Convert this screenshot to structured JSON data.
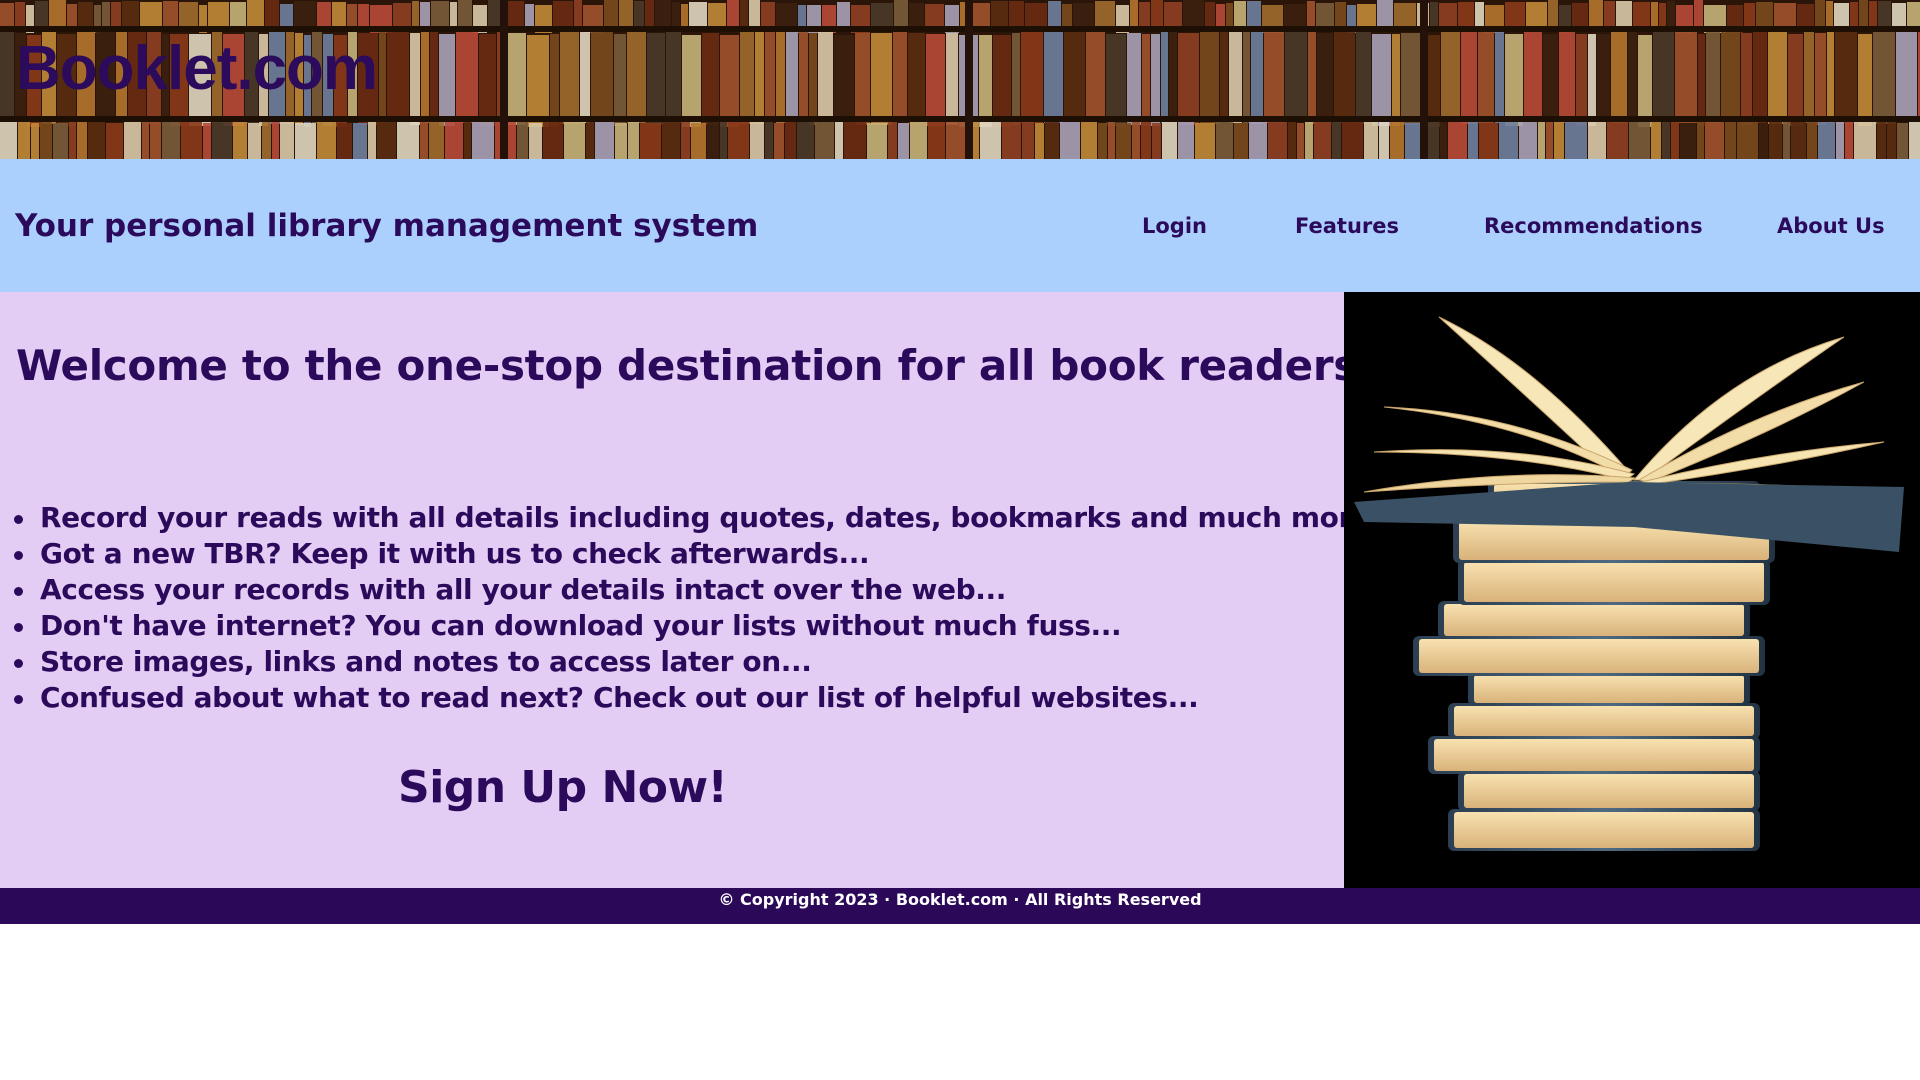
{
  "header": {
    "brand": "Booklet.com"
  },
  "nav": {
    "tagline": "Your personal library management system",
    "links": [
      {
        "label": "Login"
      },
      {
        "label": "Features"
      },
      {
        "label": "Recommendations"
      },
      {
        "label": "About Us"
      }
    ]
  },
  "main": {
    "welcome": "Welcome to the one-stop destination for all book readers!",
    "features": [
      "Record your reads with all details including quotes, dates, bookmarks and much more...",
      "Got a new TBR? Keep it with us to check afterwards...",
      "Access your records with all your details intact over the web...",
      "Don't have internet? You can download your lists without much fuss...",
      "Store images, links and notes to access later on...",
      "Confused about what to read next? Check out our list of helpful websites..."
    ],
    "cta": "Sign Up Now!"
  },
  "footer": {
    "copyright": "© Copyright 2023 · Booklet.com · All Rights Reserved"
  },
  "colors": {
    "brand_text": "#2c0a5c",
    "nav_bg": "#acd0fe",
    "main_bg": "#e4cdf5",
    "footer_bg": "#2b0858"
  },
  "images": {
    "banner": "bookshelf-photo",
    "hero": "stacked-books-photo"
  }
}
